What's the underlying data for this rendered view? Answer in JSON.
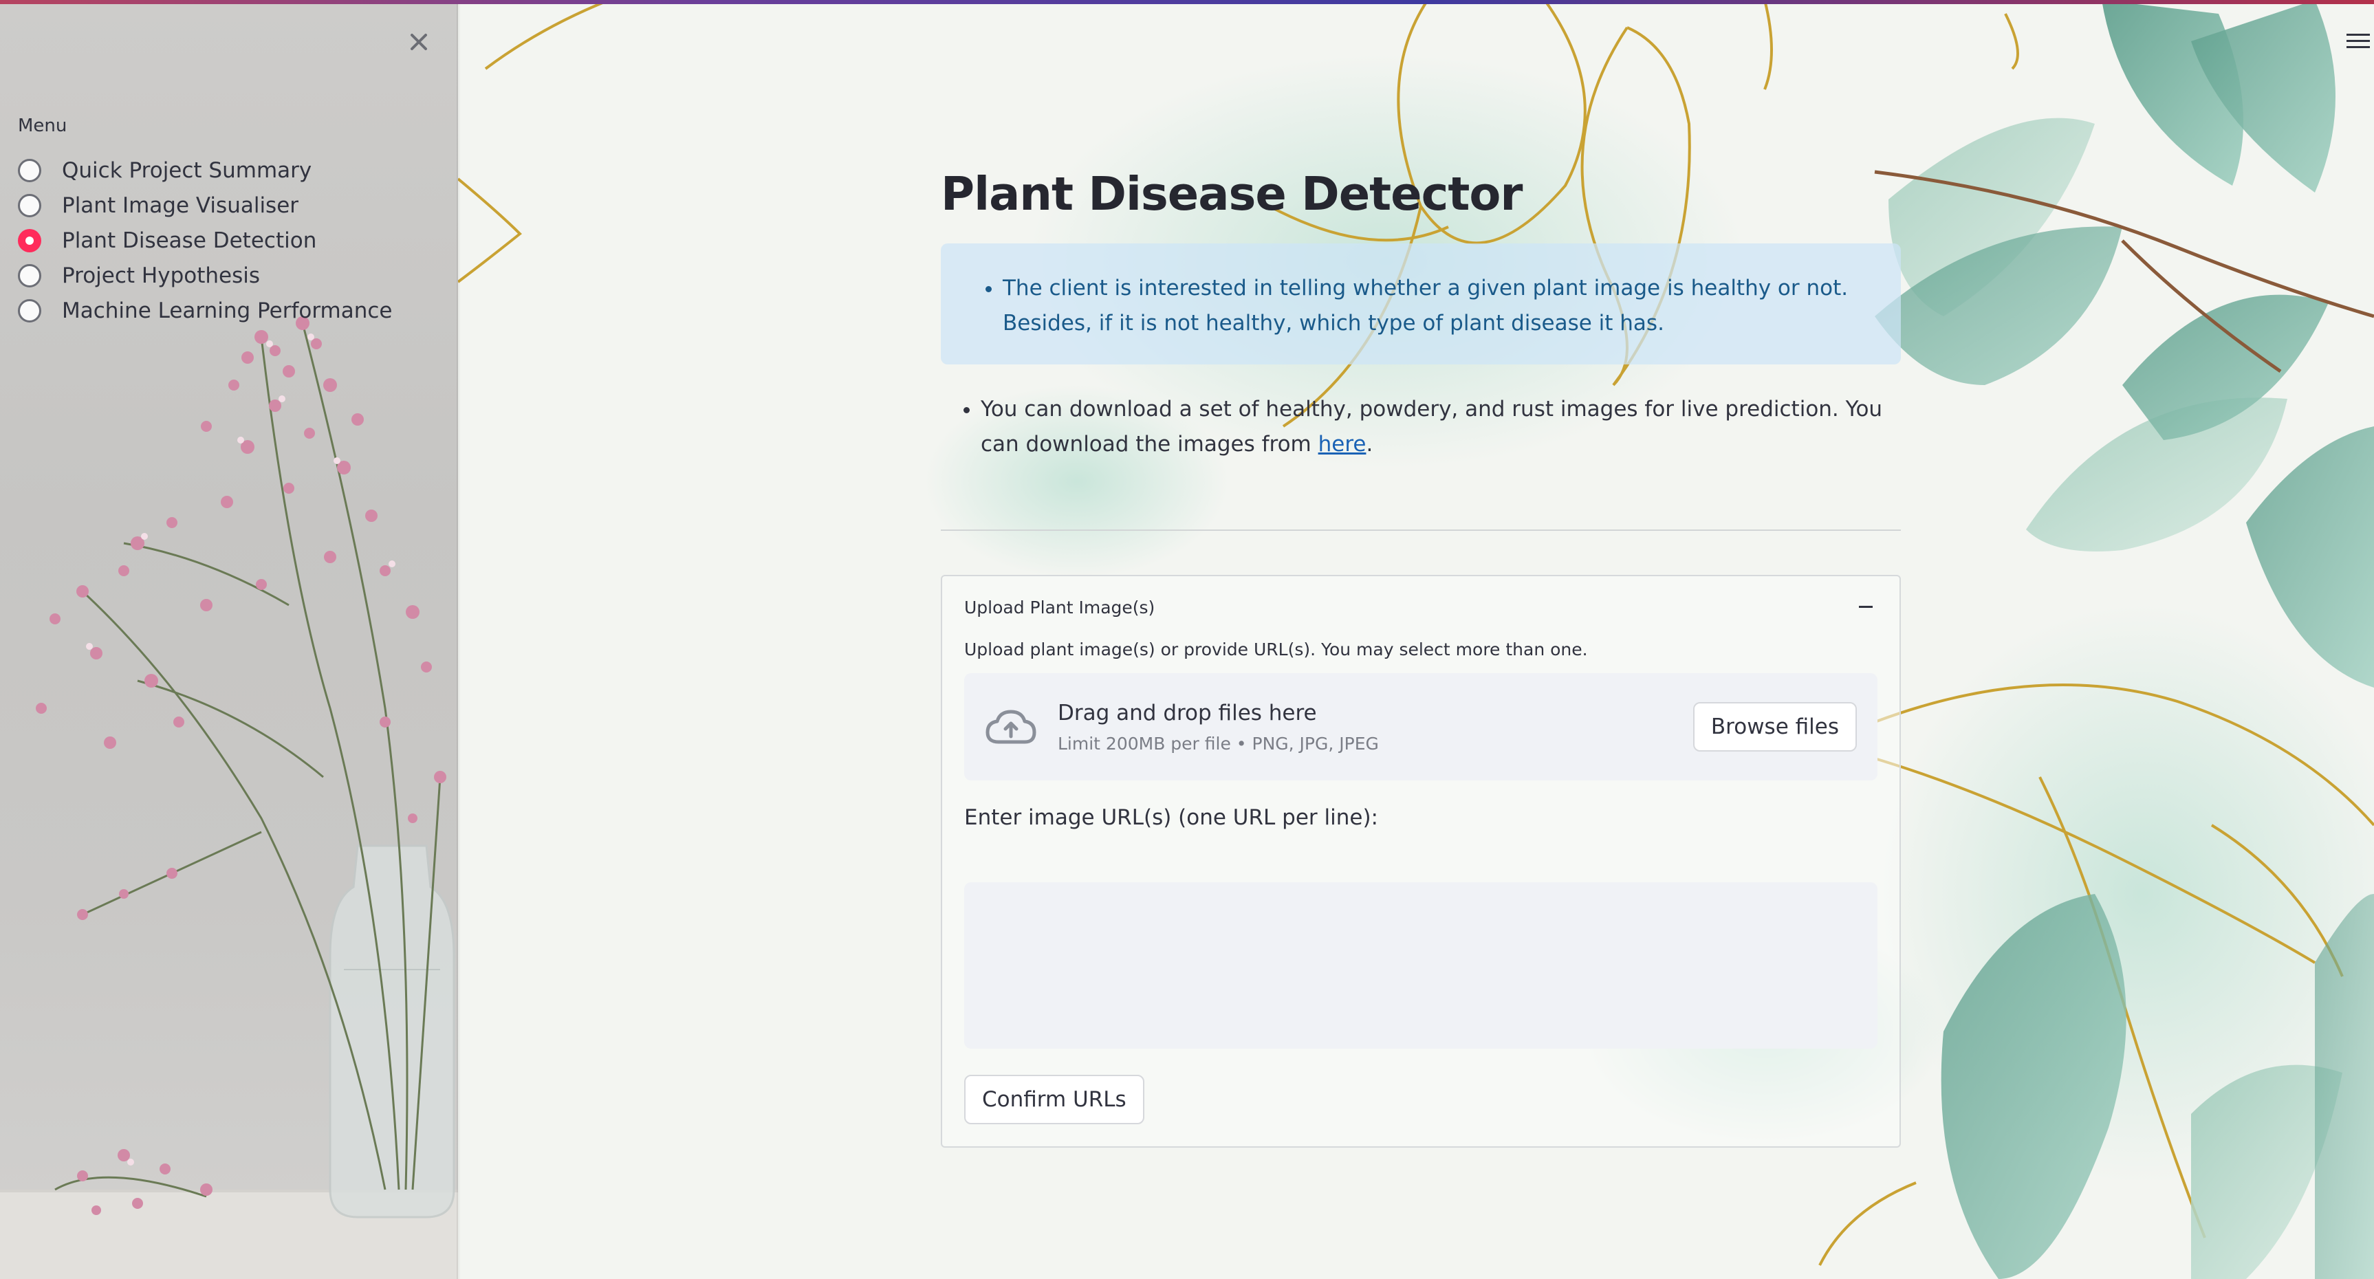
{
  "sidebar": {
    "menu_title": "Menu",
    "selected_index": 2,
    "items": [
      {
        "label": "Quick Project Summary"
      },
      {
        "label": "Plant Image Visualiser"
      },
      {
        "label": "Plant Disease Detection"
      },
      {
        "label": "Project Hypothesis"
      },
      {
        "label": "Machine Learning Performance"
      }
    ]
  },
  "main": {
    "title": "Plant Disease Detector",
    "info": "The client is interested in telling whether a given plant image is healthy or not. Besides, if it is not healthy, which type of plant disease it has.",
    "download_text": "You can download a set of healthy, powdery, and rust images for live prediction. You can download the images from ",
    "download_link": "here",
    "download_end": "."
  },
  "uploader": {
    "expander_title": "Upload Plant Image(s)",
    "description": "Upload plant image(s) or provide URL(s). You may select more than one.",
    "drop_title": "Drag and drop files here",
    "drop_limit": "Limit 200MB per file • PNG, JPG, JPEG",
    "browse_label": "Browse files",
    "url_label": "Enter image URL(s) (one URL per line):",
    "url_value": "",
    "confirm_label": "Confirm URLs"
  },
  "colors": {
    "accent": "#ff2b5b",
    "info_text": "#1a5a8a",
    "link": "#1a62b5"
  }
}
